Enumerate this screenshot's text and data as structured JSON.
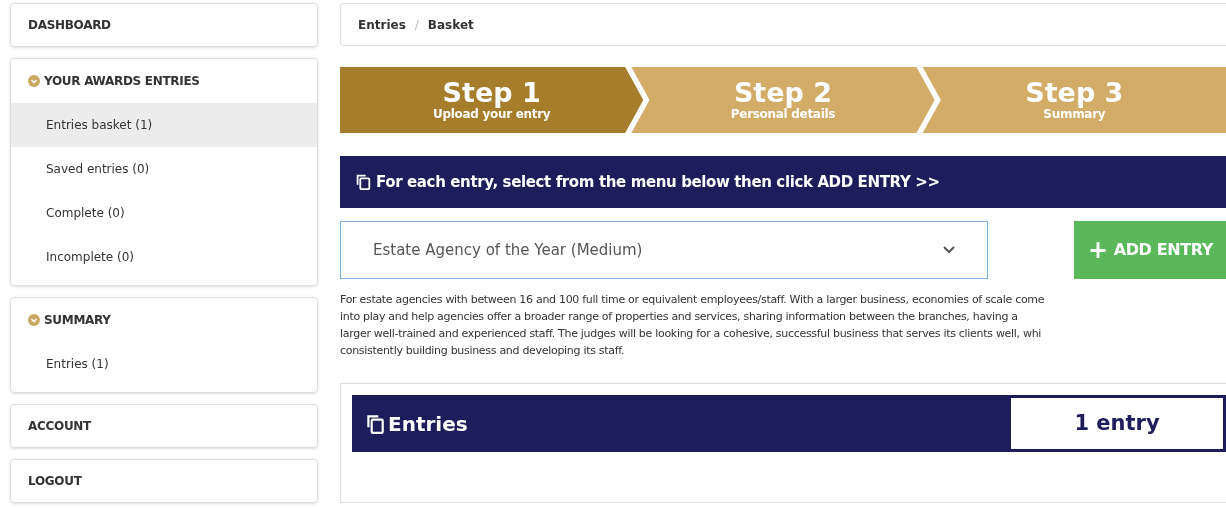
{
  "sidebar": {
    "sections": [
      {
        "kind": "link",
        "label": "DASHBOARD"
      },
      {
        "kind": "group",
        "label": "YOUR AWARDS ENTRIES",
        "expanded": true,
        "items": [
          {
            "label": "Entries basket (1)",
            "selected": true
          },
          {
            "label": "Saved entries (0)",
            "selected": false
          },
          {
            "label": "Complete (0)",
            "selected": false
          },
          {
            "label": "Incomplete (0)",
            "selected": false
          }
        ]
      },
      {
        "kind": "group",
        "label": "SUMMARY",
        "expanded": true,
        "items": [
          {
            "label": "Entries (1)",
            "selected": false
          }
        ]
      },
      {
        "kind": "link",
        "label": "ACCOUNT"
      },
      {
        "kind": "link",
        "label": "LOGOUT"
      }
    ]
  },
  "breadcrumb": [
    "Entries",
    "Basket"
  ],
  "breadcrumb_separator": "/",
  "steps": [
    {
      "title": "Step 1",
      "subtitle": "Upload your entry",
      "selected": true
    },
    {
      "title": "Step 2",
      "subtitle": "Personal details",
      "selected": false
    },
    {
      "title": "Step 3",
      "subtitle": "Summary",
      "selected": false
    }
  ],
  "instruction": "For each entry, select from the menu below then click ADD ENTRY >>",
  "category_select": {
    "value": "Estate Agency of the Year (Medium)"
  },
  "add_button": {
    "icon": "+",
    "label": "ADD ENTRY"
  },
  "description": [
    "For estate agencies with between 16 and 100 full time or equivalent employees/staff. With a larger business, economies of scale come",
    "into play and help agencies offer a broader range of properties and services, sharing information between the branches, having a",
    "larger well-trained and experienced staff. The judges will be looking for a cohesive, successful business that serves its clients well, whi",
    "consistently building business and developing its staff."
  ],
  "entries_panel": {
    "title": "Entries",
    "count": "1 entry"
  }
}
